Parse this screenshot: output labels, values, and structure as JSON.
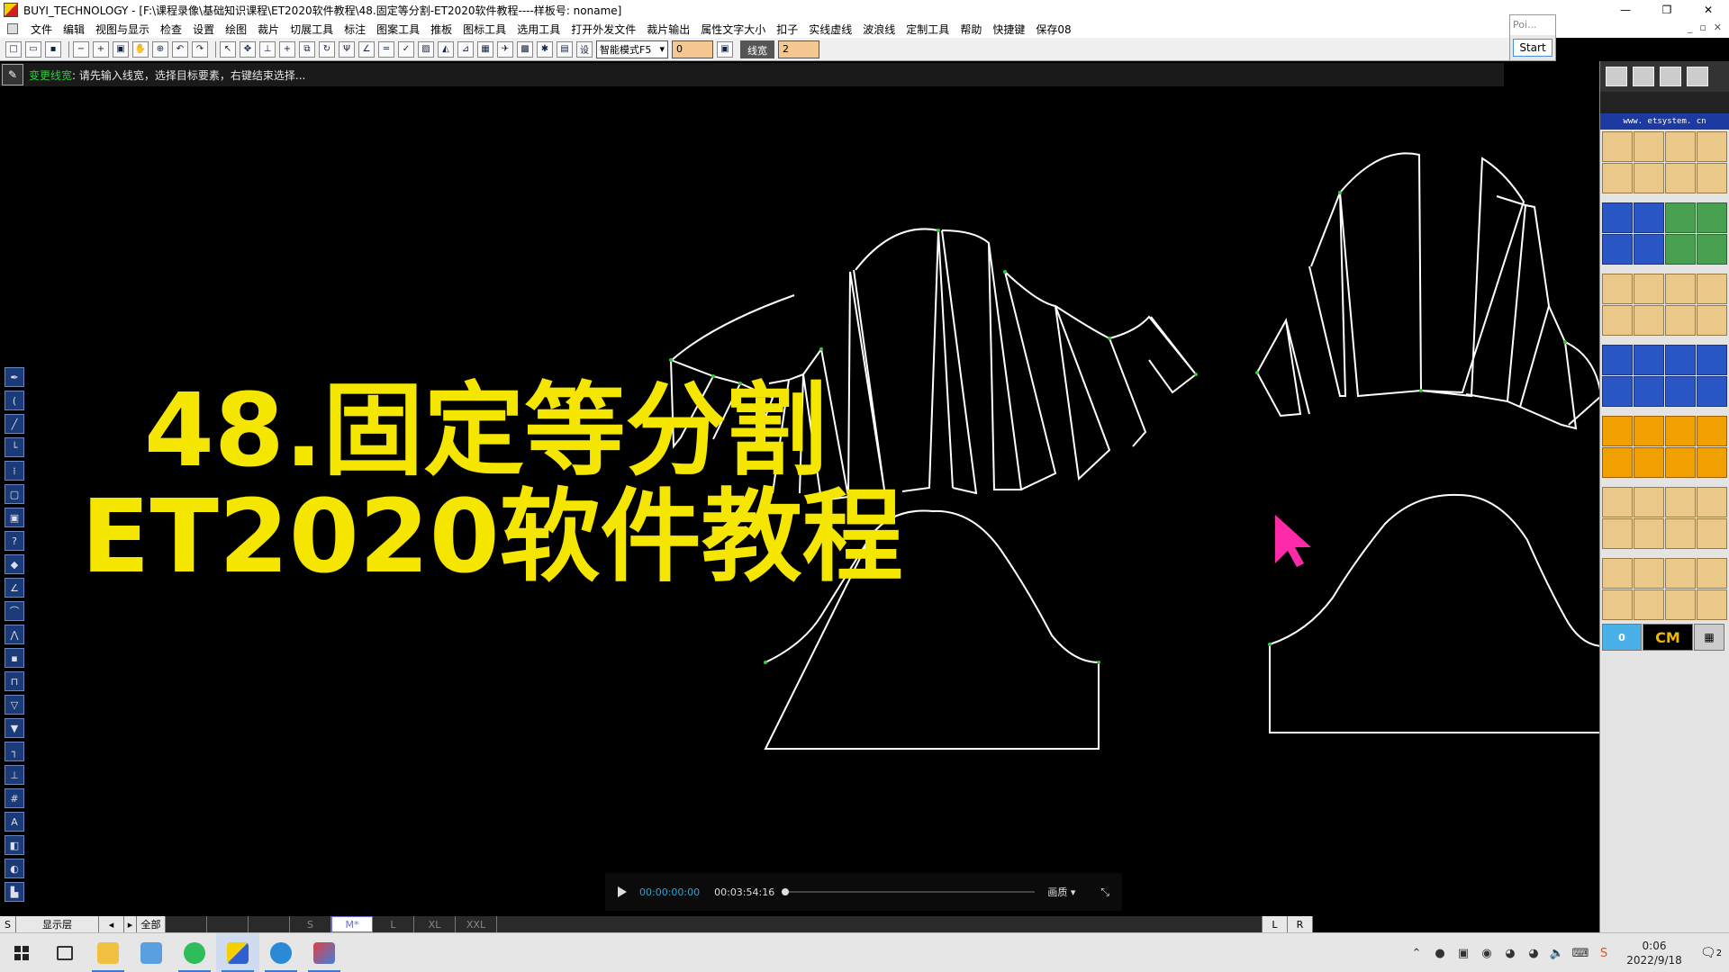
{
  "window": {
    "title": "BUYI_TECHNOLOGY - [F:\\课程录像\\基础知识课程\\ET2020软件教程\\48.固定等分割-ET2020软件教程----样板号: noname]",
    "controls": [
      "—",
      "❐",
      "✕"
    ]
  },
  "menu": {
    "items": [
      "文件",
      "编辑",
      "视图与显示",
      "检查",
      "设置",
      "绘图",
      "裁片",
      "切展工具",
      "标注",
      "图案工具",
      "推板",
      "图标工具",
      "选用工具",
      "打开外发文件",
      "裁片输出",
      "属性文字大小",
      "扣子",
      "实线虚线",
      "波浪线",
      "定制工具",
      "帮助",
      "快捷键",
      "保存08"
    ],
    "mdi_controls": [
      "_",
      "▫",
      "✕"
    ]
  },
  "toolbar": {
    "mode_select": "智能模式F5",
    "value_box": "0",
    "linewidth_label": "线宽",
    "linewidth_value": "2"
  },
  "float_window": {
    "head": "Poi...",
    "button": "Start"
  },
  "prompt": {
    "command": "变更线宽",
    "hint": ": 请先输入线宽，选择目标要素，右键结束选择..."
  },
  "overlay": {
    "line1": "48.固定等分割",
    "line2": "ET2020软件教程"
  },
  "player": {
    "current_time": "00:00:00:00",
    "total_time": "00:03:54:16",
    "progress": 0.0,
    "quality": "画质 ▾",
    "exit_fullscreen": "⤡"
  },
  "sizebar": {
    "s_label": "S",
    "layer_label": "显示层",
    "left_arrow": "◂",
    "right_arrow": "▸",
    "all_label": "全部",
    "sizes": [
      "",
      "",
      "",
      "S",
      "M*",
      "L",
      "XL",
      "XXL"
    ],
    "selected_size": "M*",
    "l_label": "L",
    "r_label": "R"
  },
  "right_panel": {
    "site": "www. etsystem. cn",
    "zero_label": "0",
    "unit_label": "CM"
  },
  "taskbar": {
    "time": "0:06",
    "date": "2022/9/18",
    "notifications": "2"
  },
  "colors": {
    "overlay_text": "#f5e600",
    "pattern_line": "#ffffff",
    "point_marker": "#33cc33",
    "cursor": "#ff2aa8",
    "player_time": "#2aa6d8"
  }
}
